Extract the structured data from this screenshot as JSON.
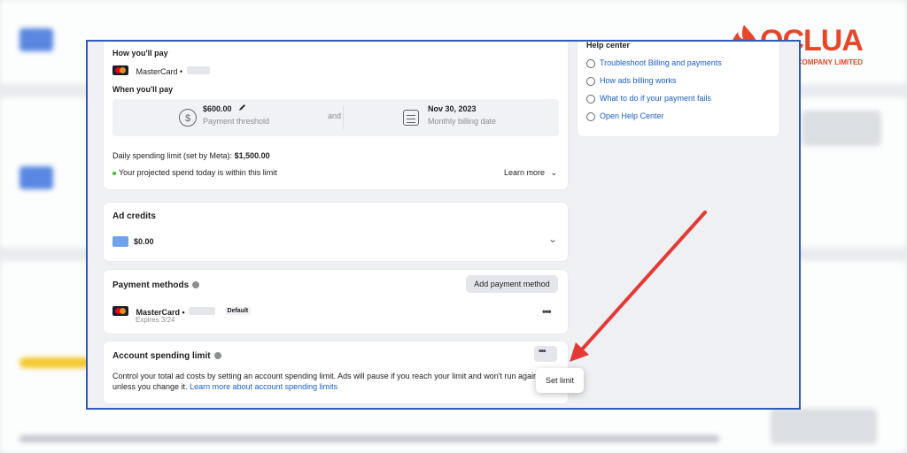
{
  "brand": {
    "name": "OCLUA",
    "subtitle": "SOCLUA COMPANY LIMITED",
    "color": "#e8462a"
  },
  "accent": "#2d5bb8",
  "arrow_color": "#e53935",
  "payment_schedule": {
    "how_label": "How you'll pay",
    "card_name": "MasterCard •",
    "when_label": "When you'll pay",
    "threshold_amount": "$600.00",
    "threshold_caption": "Payment threshold",
    "and_text": "and",
    "billing_date": "Nov 30, 2023",
    "billing_caption": "Monthly billing date",
    "daily_limit_prefix": "Daily spending limit (set by Meta):",
    "daily_limit_value": "$1,500.00",
    "projected_text": "Your projected spend today is within this limit",
    "learn_more": "Learn more"
  },
  "help_center": {
    "title": "Help center",
    "links": [
      {
        "label": "Troubleshoot Billing and payments",
        "icon": "tools-icon"
      },
      {
        "label": "How ads billing works",
        "icon": "globe-icon"
      },
      {
        "label": "What to do if your payment fails",
        "icon": "minus-circle-icon"
      },
      {
        "label": "Open Help Center",
        "icon": "question-icon"
      }
    ]
  },
  "ad_credits": {
    "title": "Ad credits",
    "amount": "$0.00"
  },
  "payment_methods": {
    "title": "Payment methods",
    "add_button": "Add payment method",
    "card_name": "MasterCard •",
    "default_badge": "Default",
    "expires": "Expires 3/24"
  },
  "account_spending_limit": {
    "title": "Account spending limit",
    "description": "Control your total ad costs by setting an account spending limit. Ads will pause if you reach your limit and won't run again unless you change it.",
    "link": "Learn more about account spending limits",
    "menu_item": "Set limit"
  }
}
